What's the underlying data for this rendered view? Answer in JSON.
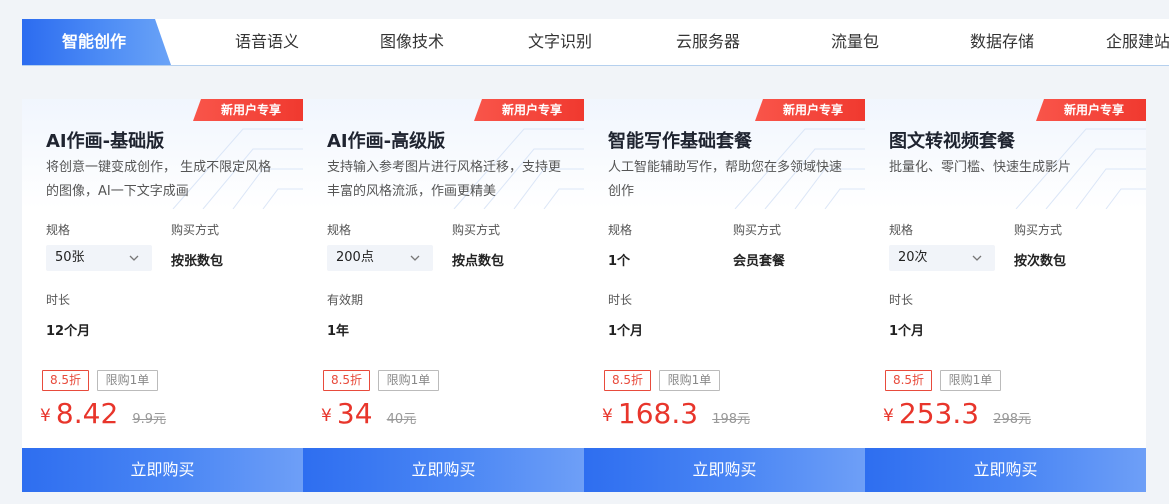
{
  "tabs": [
    {
      "label": "智能创作",
      "active": true
    },
    {
      "label": "语音语义"
    },
    {
      "label": "图像技术"
    },
    {
      "label": "文字识别"
    },
    {
      "label": "云服务器"
    },
    {
      "label": "流量包"
    },
    {
      "label": "数据存储"
    },
    {
      "label": "企服建站"
    }
  ],
  "colors": {
    "accent": "#2c6cf0",
    "badge": "#f0392f",
    "price": "#e8352b"
  },
  "cards": [
    {
      "badge": "新用户专享",
      "title": "AI作画-基础版",
      "desc": "将创意一键变成创作， 生成不限定风格的图像，AI一下文字成画",
      "spec_label": "规格",
      "spec_value": "50张",
      "buy_mode_label": "购买方式",
      "buy_mode_value": "按张数包",
      "duration_label": "时长",
      "duration_value": "12个月",
      "discount_tag": "8.5折",
      "limit_tag": "限购1单",
      "currency": "¥",
      "price": "8.42",
      "original_price": "9.9元",
      "buy_label": "立即购买"
    },
    {
      "badge": "新用户专享",
      "title": "AI作画-高级版",
      "desc": "支持输入参考图片进行风格迁移，支持更丰富的风格流派，作画更精美",
      "spec_label": "规格",
      "spec_value": "200点",
      "buy_mode_label": "购买方式",
      "buy_mode_value": "按点数包",
      "duration_label": "有效期",
      "duration_value": "1年",
      "discount_tag": "8.5折",
      "limit_tag": "限购1单",
      "currency": "¥",
      "price": "34",
      "original_price": "40元",
      "buy_label": "立即购买"
    },
    {
      "badge": "新用户专享",
      "title": "智能写作基础套餐",
      "desc": "人工智能辅助写作，帮助您在多领域快速创作",
      "spec_label": "规格",
      "spec_value": "1个",
      "buy_mode_label": "购买方式",
      "buy_mode_value": "会员套餐",
      "duration_label": "时长",
      "duration_value": "1个月",
      "discount_tag": "8.5折",
      "limit_tag": "限购1单",
      "currency": "¥",
      "price": "168.3",
      "original_price": "198元",
      "buy_label": "立即购买"
    },
    {
      "badge": "新用户专享",
      "title": "图文转视频套餐",
      "desc": "批量化、零门槛、快速生成影片",
      "spec_label": "规格",
      "spec_value": "20次",
      "buy_mode_label": "购买方式",
      "buy_mode_value": "按次数包",
      "duration_label": "时长",
      "duration_value": "1个月",
      "discount_tag": "8.5折",
      "limit_tag": "限购1单",
      "currency": "¥",
      "price": "253.3",
      "original_price": "298元",
      "buy_label": "立即购买"
    }
  ]
}
